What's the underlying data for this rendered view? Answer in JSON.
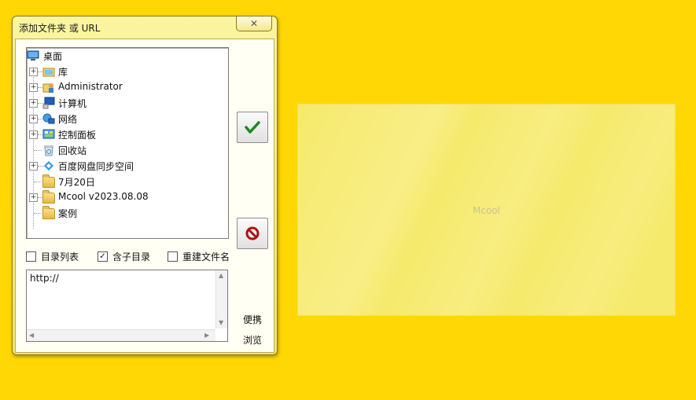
{
  "dialog": {
    "title": "添加文件夹 或 URL",
    "close_glyph": "✕",
    "tree": [
      {
        "label": "桌面",
        "icon": "desktop-icon",
        "expandable": false,
        "level": 0
      },
      {
        "label": "库",
        "icon": "library-folder-icon",
        "expandable": true,
        "level": 1
      },
      {
        "label": "Administrator",
        "icon": "user-folder-icon",
        "expandable": true,
        "level": 1
      },
      {
        "label": "计算机",
        "icon": "computer-icon",
        "expandable": true,
        "level": 1
      },
      {
        "label": "网络",
        "icon": "network-icon",
        "expandable": true,
        "level": 1
      },
      {
        "label": "控制面板",
        "icon": "control-panel-icon",
        "expandable": true,
        "level": 1
      },
      {
        "label": "回收站",
        "icon": "recycle-bin-icon",
        "expandable": false,
        "level": 1
      },
      {
        "label": "百度网盘同步空间",
        "icon": "baidu-netdisk-icon",
        "expandable": true,
        "level": 1
      },
      {
        "label": "7月20日",
        "icon": "folder-icon",
        "expandable": false,
        "level": 1
      },
      {
        "label": "Mcool v2023.08.08",
        "icon": "folder-icon",
        "expandable": true,
        "level": 1
      },
      {
        "label": "案例",
        "icon": "folder-icon",
        "expandable": false,
        "level": 1
      }
    ],
    "options": {
      "dir_list": {
        "label": "目录列表",
        "checked": false
      },
      "include_subdirs": {
        "label": "含子目录",
        "checked": true
      },
      "rebuild_name": {
        "label": "重建文件名",
        "checked": false
      }
    },
    "url_value": "http://",
    "links": {
      "portable": "便携",
      "browse": "浏览"
    },
    "ok_color": "#1a8a1a",
    "cancel_color": "#b01010"
  },
  "preview": {
    "label": "Mcool"
  }
}
